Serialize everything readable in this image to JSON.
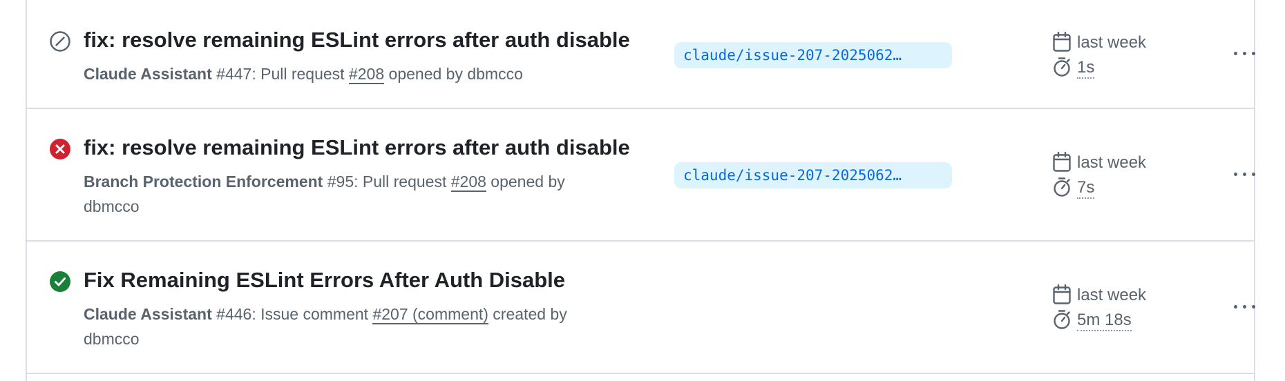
{
  "runs": [
    {
      "status": "cancelled",
      "title": "fix: resolve remaining ESLint errors after auth disable",
      "workflow": "Claude Assistant",
      "run_number": "#447",
      "event_prefix": ": Pull request ",
      "ref": "#208",
      "event_suffix": " opened by dbmcco",
      "branch": "claude/issue-207-2025062…",
      "when": "last week",
      "duration": "1s"
    },
    {
      "status": "failure",
      "title": "fix: resolve remaining ESLint errors after auth disable",
      "workflow": "Branch Protection Enforcement",
      "run_number": "#95",
      "event_prefix": ": Pull request ",
      "ref": "#208",
      "event_suffix": " opened by dbmcco",
      "branch": "claude/issue-207-2025062…",
      "when": "last week",
      "duration": "7s"
    },
    {
      "status": "success",
      "title": "Fix Remaining ESLint Errors After Auth Disable",
      "workflow": "Claude Assistant",
      "run_number": "#446",
      "event_prefix": ": Issue comment ",
      "ref": "#207 (comment)",
      "event_suffix": " created by dbmcco",
      "branch": "",
      "when": "last week",
      "duration": "5m 18s"
    }
  ],
  "colors": {
    "cancelled": "#59636e",
    "failure": "#cf222e",
    "success": "#1a7f37",
    "branch_bg": "#ddf4ff",
    "branch_fg": "#0969da"
  },
  "icons": {
    "cancelled": "skip-circle-icon",
    "failure": "x-circle-fill-icon",
    "success": "check-circle-fill-icon",
    "calendar": "calendar-icon",
    "stopwatch": "stopwatch-icon",
    "menu": "kebab-horizontal-icon"
  }
}
